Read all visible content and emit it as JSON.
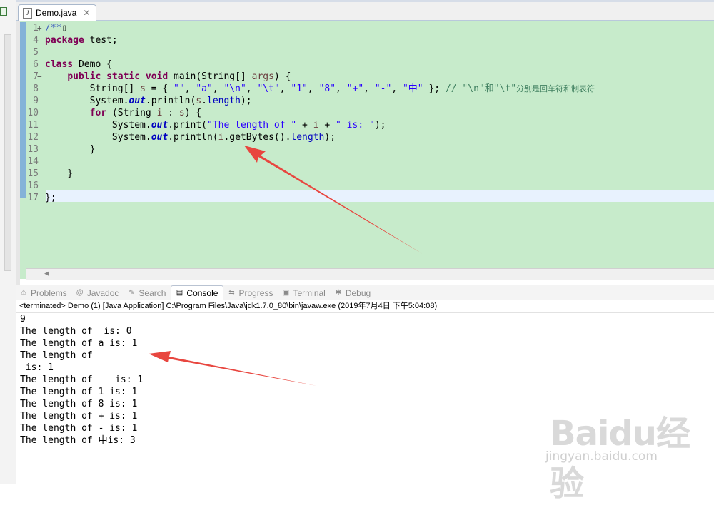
{
  "editor": {
    "tab_label": "Demo.java",
    "lines": [
      {
        "num": "1",
        "fold": "+",
        "parts": [
          [
            "jvdoc",
            "/**"
          ],
          [
            "txt",
            "▯"
          ]
        ]
      },
      {
        "num": "4",
        "fold": "",
        "parts": [
          [
            "kw",
            "package"
          ],
          [
            "txt",
            " test;"
          ]
        ]
      },
      {
        "num": "5",
        "fold": "",
        "parts": []
      },
      {
        "num": "6",
        "fold": "",
        "parts": [
          [
            "kw",
            "class"
          ],
          [
            "txt",
            " Demo {"
          ]
        ]
      },
      {
        "num": "7",
        "fold": "−",
        "parts": [
          [
            "txt",
            "    "
          ],
          [
            "kw",
            "public"
          ],
          [
            "txt",
            " "
          ],
          [
            "kw",
            "static"
          ],
          [
            "txt",
            " "
          ],
          [
            "kw",
            "void"
          ],
          [
            "txt",
            " main(String[] "
          ],
          [
            "vr",
            "args"
          ],
          [
            "txt",
            ") {"
          ]
        ]
      },
      {
        "num": "8",
        "fold": "",
        "parts": [
          [
            "txt",
            "        String[] "
          ],
          [
            "vr",
            "s"
          ],
          [
            "txt",
            " = { "
          ],
          [
            "str",
            "\"\""
          ],
          [
            "txt",
            ", "
          ],
          [
            "str",
            "\"a\""
          ],
          [
            "txt",
            ", "
          ],
          [
            "str",
            "\"\\n\""
          ],
          [
            "txt",
            ", "
          ],
          [
            "str",
            "\"\\t\""
          ],
          [
            "txt",
            ", "
          ],
          [
            "str",
            "\"1\""
          ],
          [
            "txt",
            ", "
          ],
          [
            "str",
            "\"8\""
          ],
          [
            "txt",
            ", "
          ],
          [
            "str",
            "\"+\""
          ],
          [
            "txt",
            ", "
          ],
          [
            "str",
            "\"-\""
          ],
          [
            "txt",
            ", "
          ],
          [
            "str",
            "\"中\""
          ],
          [
            "txt",
            " }; "
          ],
          [
            "cm",
            "// \"\\n\"和\"\\t\""
          ],
          [
            "cmj",
            "分别是回车符和制表符"
          ]
        ]
      },
      {
        "num": "9",
        "fold": "",
        "parts": [
          [
            "txt",
            "        System."
          ],
          [
            "fld",
            "out"
          ],
          [
            "txt",
            ".println("
          ],
          [
            "vr",
            "s"
          ],
          [
            "txt",
            "."
          ],
          [
            "len",
            "length"
          ],
          [
            "txt",
            ");"
          ]
        ]
      },
      {
        "num": "10",
        "fold": "",
        "parts": [
          [
            "txt",
            "        "
          ],
          [
            "kw",
            "for"
          ],
          [
            "txt",
            " (String "
          ],
          [
            "vr",
            "i"
          ],
          [
            "txt",
            " : "
          ],
          [
            "vr",
            "s"
          ],
          [
            "txt",
            ") {"
          ]
        ]
      },
      {
        "num": "11",
        "fold": "",
        "parts": [
          [
            "txt",
            "            System."
          ],
          [
            "fld",
            "out"
          ],
          [
            "txt",
            ".print("
          ],
          [
            "str",
            "\"The length of \""
          ],
          [
            "txt",
            " + "
          ],
          [
            "vr",
            "i"
          ],
          [
            "txt",
            " + "
          ],
          [
            "str",
            "\" is: \""
          ],
          [
            "txt",
            ");"
          ]
        ]
      },
      {
        "num": "12",
        "fold": "",
        "parts": [
          [
            "txt",
            "            System."
          ],
          [
            "fld",
            "out"
          ],
          [
            "txt",
            ".println("
          ],
          [
            "vr",
            "i"
          ],
          [
            "txt",
            ".getBytes()."
          ],
          [
            "len",
            "length"
          ],
          [
            "txt",
            ");"
          ]
        ]
      },
      {
        "num": "13",
        "fold": "",
        "parts": [
          [
            "txt",
            "        }"
          ]
        ]
      },
      {
        "num": "14",
        "fold": "",
        "parts": []
      },
      {
        "num": "15",
        "fold": "",
        "parts": [
          [
            "txt",
            "    }"
          ]
        ]
      },
      {
        "num": "16",
        "fold": "",
        "parts": []
      },
      {
        "num": "17",
        "fold": "",
        "parts": [
          [
            "txt",
            "};"
          ]
        ]
      }
    ]
  },
  "console": {
    "tabs": [
      {
        "label": "Problems",
        "icon": "problems-icon",
        "glyph": "⚠",
        "active": false
      },
      {
        "label": "Javadoc",
        "icon": "javadoc-icon",
        "glyph": "@",
        "active": false
      },
      {
        "label": "Search",
        "icon": "search-icon",
        "glyph": "✎",
        "active": false
      },
      {
        "label": "Console",
        "icon": "console-icon",
        "glyph": "▤",
        "active": true
      },
      {
        "label": "Progress",
        "icon": "progress-icon",
        "glyph": "⇆",
        "active": false
      },
      {
        "label": "Terminal",
        "icon": "terminal-icon",
        "glyph": "▣",
        "active": false
      },
      {
        "label": "Debug",
        "icon": "debug-icon",
        "glyph": "✱",
        "active": false
      }
    ],
    "header": "<terminated> Demo (1) [Java Application] C:\\Program Files\\Java\\jdk1.7.0_80\\bin\\javaw.exe (2019年7月4日 下午5:04:08)",
    "output": [
      "9",
      "The length of  is: 0",
      "The length of a is: 1",
      "The length of ",
      " is: 1",
      "The length of \t is: 1",
      "The length of 1 is: 1",
      "The length of 8 is: 1",
      "The length of + is: 1",
      "The length of - is: 1",
      "The length of 中is: 3"
    ]
  },
  "watermark": {
    "logo": "Baidu经验",
    "url": "jingyan.baidu.com"
  },
  "colors": {
    "editor_bg": "#c7ebcb",
    "keyword": "#7f0055",
    "string": "#2a00ff",
    "comment": "#3f7f5f",
    "field": "#0000c0",
    "arrow": "#e8463f"
  }
}
